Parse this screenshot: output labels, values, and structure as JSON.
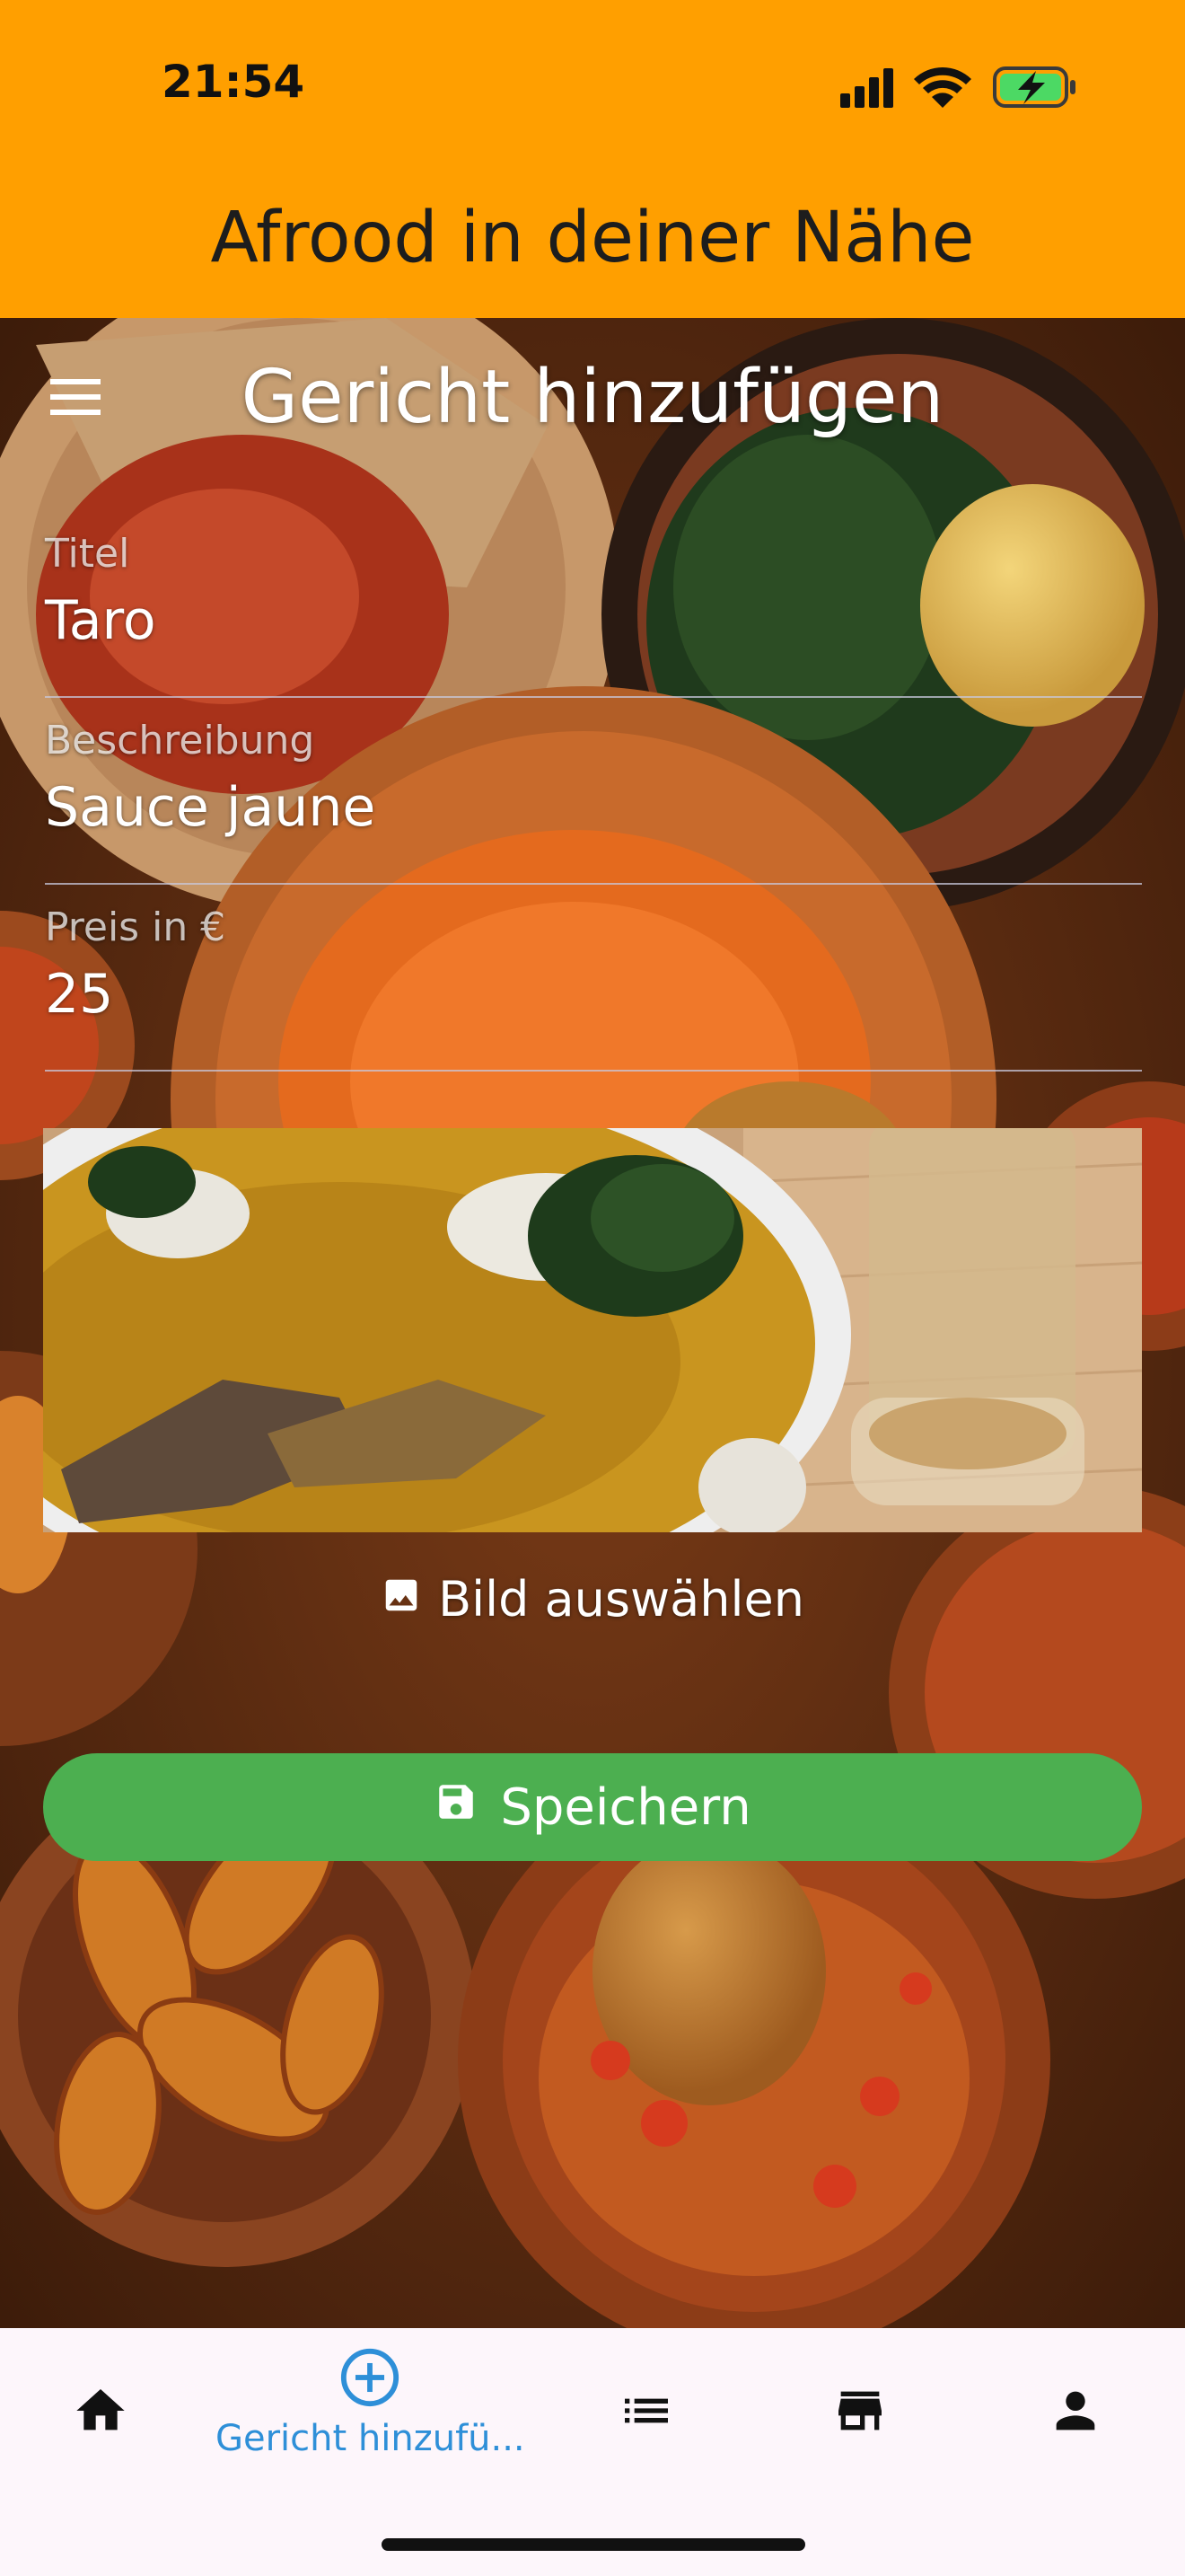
{
  "status_bar": {
    "time": "21:54"
  },
  "app_bar": {
    "title": "Afrood in deiner Nähe"
  },
  "screen": {
    "title": "Gericht hinzufügen"
  },
  "form": {
    "title": {
      "label": "Titel",
      "value": "Taro"
    },
    "description": {
      "label": "Beschreibung",
      "value": "Sauce jaune"
    },
    "price": {
      "label": "Preis in €",
      "value": "25"
    }
  },
  "image_picker": {
    "label": "Bild auswählen",
    "icon": "image-icon"
  },
  "save_button": {
    "label": "Speichern",
    "icon": "save-icon",
    "color": "#4caf50"
  },
  "bottom_nav": {
    "items": [
      {
        "icon": "home-icon"
      },
      {
        "icon": "add-circle-icon",
        "label": "Gericht hinzufü...",
        "active": true
      },
      {
        "icon": "list-icon"
      },
      {
        "icon": "store-icon"
      },
      {
        "icon": "person-icon"
      }
    ]
  },
  "colors": {
    "app_bar": "#ff9f00",
    "accent": "#2e8fd8",
    "nav_background": "#fdf6fb"
  }
}
